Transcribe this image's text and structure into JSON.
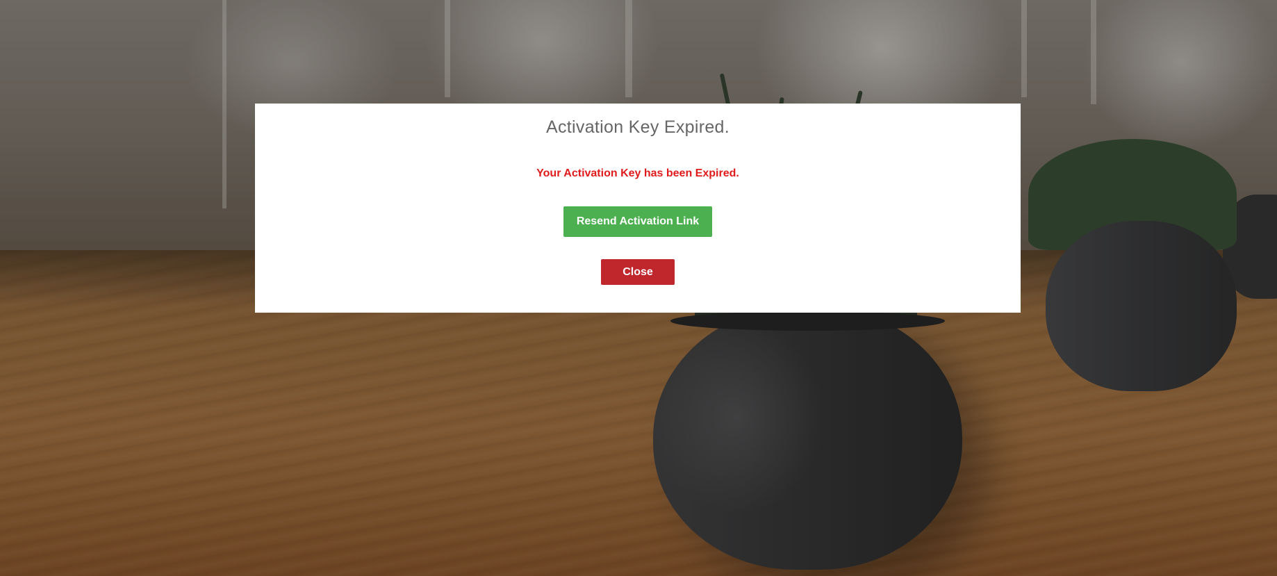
{
  "modal": {
    "title": "Activation Key Expired.",
    "message": "Your Activation Key has been Expired.",
    "resend_button_label": "Resend Activation Link",
    "close_button_label": "Close"
  },
  "colors": {
    "title_text": "#666666",
    "message_text": "#e01b1b",
    "resend_button": "#4caf50",
    "close_button": "#c0272d",
    "modal_background": "#ffffff"
  }
}
